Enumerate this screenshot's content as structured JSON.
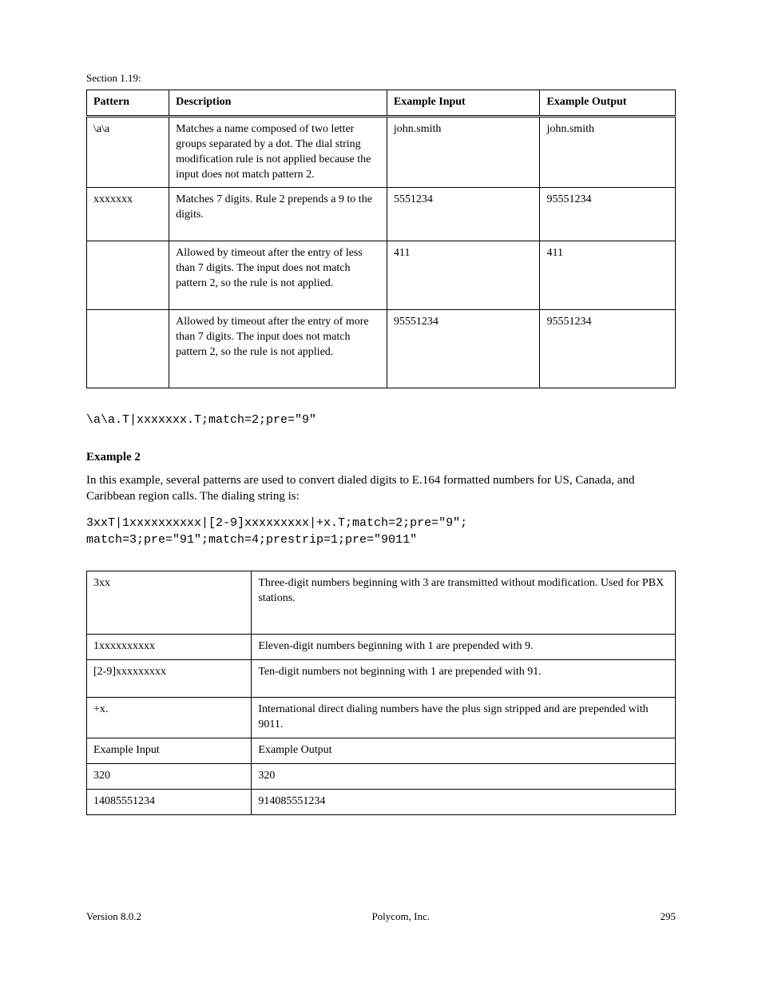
{
  "section_label": "Section 1.19:",
  "code1": "\\a\\a.T|xxxxxxx.T;match=2;pre=\"9\"",
  "sub_heading": "Example 2",
  "para2": "In this example, several patterns are used to convert dialed digits to E.164 formatted numbers for US, Canada, and Caribbean region calls. The dialing string is:",
  "code2": "3xxT|1xxxxxxxxxx|[2-9]xxxxxxxxx|+x.T;match=2;pre=\"9\";\nmatch=3;pre=\"91\";match=4;prestrip=1;pre=\"9011\"",
  "t1": {
    "headers": [
      "Pattern",
      "Description",
      "Example Input",
      "Example Output"
    ],
    "rows": [
      [
        "\\a\\a",
        "Matches a name composed of two letter groups separated by a dot. The dial string modification rule is not applied because the input does not match pattern 2.",
        "john.smith",
        "john.smith"
      ],
      [
        "xxxxxxx",
        "Matches 7 digits. Rule 2 prepends a 9 to the digits.",
        "5551234",
        "95551234"
      ],
      [
        "",
        "Allowed by timeout after the entry of less than 7 digits. The input does not match pattern 2, so the rule is not applied.",
        "411",
        "411"
      ],
      [
        "",
        "Allowed by timeout after the entry of more than 7 digits. The input does not match pattern 2, so the rule is not applied.",
        "95551234",
        "95551234"
      ]
    ]
  },
  "t2": {
    "rows": [
      [
        "3xx",
        "Three-digit numbers beginning with 3 are transmitted without modification. Used for PBX stations."
      ],
      [
        "1xxxxxxxxxx",
        "Eleven-digit numbers beginning with 1 are prepended with 9."
      ],
      [
        "[2-9]xxxxxxxxx",
        "Ten-digit numbers not beginning with 1 are prepended with 91."
      ],
      [
        "+x.",
        "International direct dialing numbers have the plus sign stripped and are prepended with 9011."
      ],
      [
        "Example Input",
        "Example Output"
      ],
      [
        "320",
        "320"
      ],
      [
        "14085551234",
        "914085551234"
      ]
    ]
  },
  "footer_left": "Version 8.0.2",
  "footer_center": "Polycom, Inc.",
  "footer_right": "295"
}
